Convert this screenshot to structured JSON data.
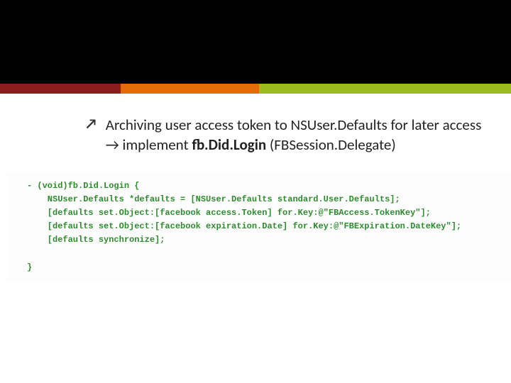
{
  "bullet": {
    "t1": "Archiving user access token to NSUser.Defaults for later access ",
    "arrow": "→",
    "t2": " implement ",
    "bold": "fb.Did.Login",
    "t3": " (FBSession.Delegate)"
  },
  "code": {
    "l1": "- (void)fb.Did.Login {",
    "l2": "    NSUser.Defaults *defaults = [NSUser.Defaults standard.User.Defaults];",
    "l3": "    [defaults set.Object:[facebook access.Token] for.Key:@\"FBAccess.TokenKey\"];",
    "l4": "    [defaults set.Object:[facebook expiration.Date] for.Key:@\"FBExpiration.DateKey\"];",
    "l5": "    [defaults synchronize];",
    "l6": "}"
  }
}
